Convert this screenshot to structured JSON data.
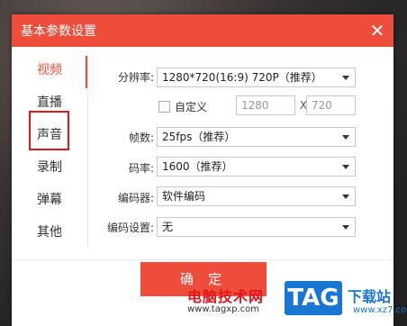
{
  "dialog": {
    "title": "基本参数设置",
    "close_glyph": "✕",
    "confirm_label": "确 定"
  },
  "sidebar": {
    "items": [
      {
        "label": "视频",
        "active": true
      },
      {
        "label": "直播",
        "active": false
      },
      {
        "label": "声音",
        "active": false,
        "highlighted": true
      },
      {
        "label": "录制",
        "active": false
      },
      {
        "label": "弹幕",
        "active": false
      },
      {
        "label": "其他",
        "active": false
      }
    ]
  },
  "video": {
    "resolution_label": "分辨率:",
    "resolution_value": "1280*720(16:9) 720P（推荐）",
    "custom_label": "自定义",
    "custom_checked": false,
    "custom_width": "1280",
    "custom_x": "X",
    "custom_height": "720",
    "fps_label": "帧数:",
    "fps_value": "25fps（推荐）",
    "bitrate_label": "码率:",
    "bitrate_value": "1600（推荐）",
    "encoder_label": "编码器:",
    "encoder_value": "软件编码",
    "encoder_settings_label": "编码设置:",
    "encoder_settings_value": "无"
  },
  "watermark": {
    "text": "电脑技术网",
    "url": "www.tagxp.com",
    "tag": "TAG",
    "download": "下载站",
    "site": "www.xz7.com"
  },
  "colors": {
    "accent": "#ef4d3c",
    "highlight_box": "#e0161b",
    "watermark_blue": "#1976d2"
  }
}
